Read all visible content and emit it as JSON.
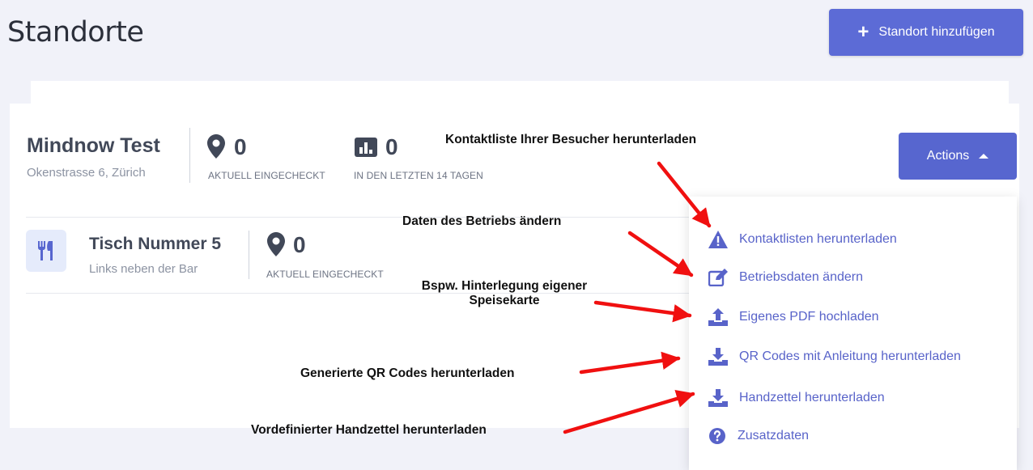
{
  "header": {
    "title": "Standorte",
    "add_button_label": "Standort hinzufügen"
  },
  "location": {
    "name": "Mindnow Test",
    "address": "Okenstrasse 6, Zürich",
    "stats": [
      {
        "icon": "map-marker-icon",
        "value": "0",
        "caption": "AKTUELL EINGECHECKT"
      },
      {
        "icon": "bar-chart-icon",
        "value": "0",
        "caption": "IN DEN LETZTEN 14 TAGEN"
      }
    ],
    "actions_label": "Actions"
  },
  "table": {
    "icon": "utensils-icon",
    "name": "Tisch Nummer 5",
    "description": "Links neben der Bar",
    "stat": {
      "icon": "map-marker-icon",
      "value": "0",
      "caption": "AKTUELL EINGECHECKT"
    }
  },
  "actions_menu": {
    "items": [
      {
        "icon": "warning-triangle-icon",
        "label": "Kontaktlisten herunterladen"
      },
      {
        "icon": "edit-icon",
        "label": "Betriebsdaten ändern"
      },
      {
        "icon": "upload-icon",
        "label": "Eigenes PDF hochladen"
      },
      {
        "icon": "download-icon",
        "label": "QR Codes mit Anleitung herunterladen"
      },
      {
        "icon": "download-icon",
        "label": "Handzettel herunterladen"
      },
      {
        "icon": "question-circle-icon",
        "label": "Zusatzdaten"
      }
    ]
  },
  "annotations": {
    "kontaktliste": "Kontaktliste Ihrer Besucher herunterladen",
    "betrieb": "Daten des Betriebs ändern",
    "speisekarte_line1": "Bspw. Hinterlegung eigener",
    "speisekarte_line2": "Speisekarte",
    "qr": "Generierte QR Codes herunterladen",
    "handzettel": "Vordefinierter Handzettel herunterladen"
  },
  "colors": {
    "accent": "#5c6bd6",
    "menu_text": "#5863c9",
    "annotation_arrow": "#f01010",
    "background": "#f1f2f9"
  }
}
